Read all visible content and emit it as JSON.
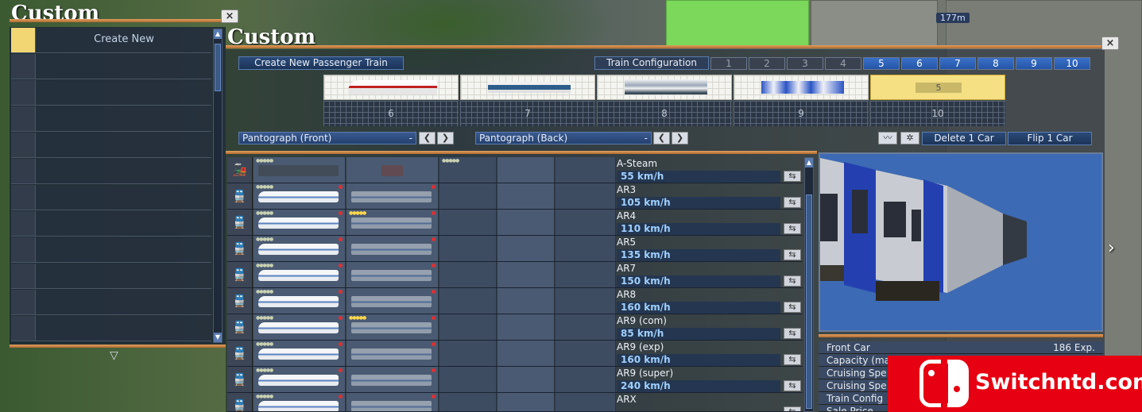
{
  "world": {
    "distance": "177m"
  },
  "left_panel": {
    "title": "Custom",
    "close": "×",
    "create_new": "Create New"
  },
  "main_panel": {
    "title": "Custom",
    "close": "×",
    "create_btn": "Create New Passenger Train",
    "config_label": "Train Configuration",
    "tabs": [
      "1",
      "2",
      "3",
      "4",
      "5",
      "6",
      "7",
      "8",
      "9",
      "10"
    ],
    "car_slots": [
      "6",
      "7",
      "8",
      "9",
      "10"
    ],
    "selected_car_label": "5",
    "pantograph_front": {
      "label": "Pantograph (Front)",
      "value": "-"
    },
    "pantograph_back": {
      "label": "Pantograph (Back)",
      "value": "-"
    },
    "delete_btn": "Delete 1 Car",
    "flip_btn": "Flip 1 Car",
    "trains": [
      {
        "name": "A-Steam",
        "speed": "55 km/h"
      },
      {
        "name": "AR3",
        "speed": "105 km/h"
      },
      {
        "name": "AR4",
        "speed": "110 km/h"
      },
      {
        "name": "AR5",
        "speed": "135 km/h"
      },
      {
        "name": "AR7",
        "speed": "150 km/h"
      },
      {
        "name": "AR8",
        "speed": "160 km/h"
      },
      {
        "name": "AR9 (com)",
        "speed": "85 km/h"
      },
      {
        "name": "AR9 (exp)",
        "speed": "160 km/h"
      },
      {
        "name": "AR9 (super)",
        "speed": "240 km/h"
      },
      {
        "name": "ARX",
        "speed": ""
      }
    ],
    "stats": [
      {
        "label": "Front Car",
        "value": "186 Exp."
      },
      {
        "label": "Capacity (ma",
        "value": ""
      },
      {
        "label": "Cruising Spe",
        "value": ""
      },
      {
        "label": "Cruising Spe",
        "value": ""
      },
      {
        "label": "Train Config",
        "value": ""
      },
      {
        "label": "Sale Price",
        "value": ""
      }
    ]
  },
  "watermark": {
    "text": "Switchntd.com",
    "color": "#e60012"
  }
}
